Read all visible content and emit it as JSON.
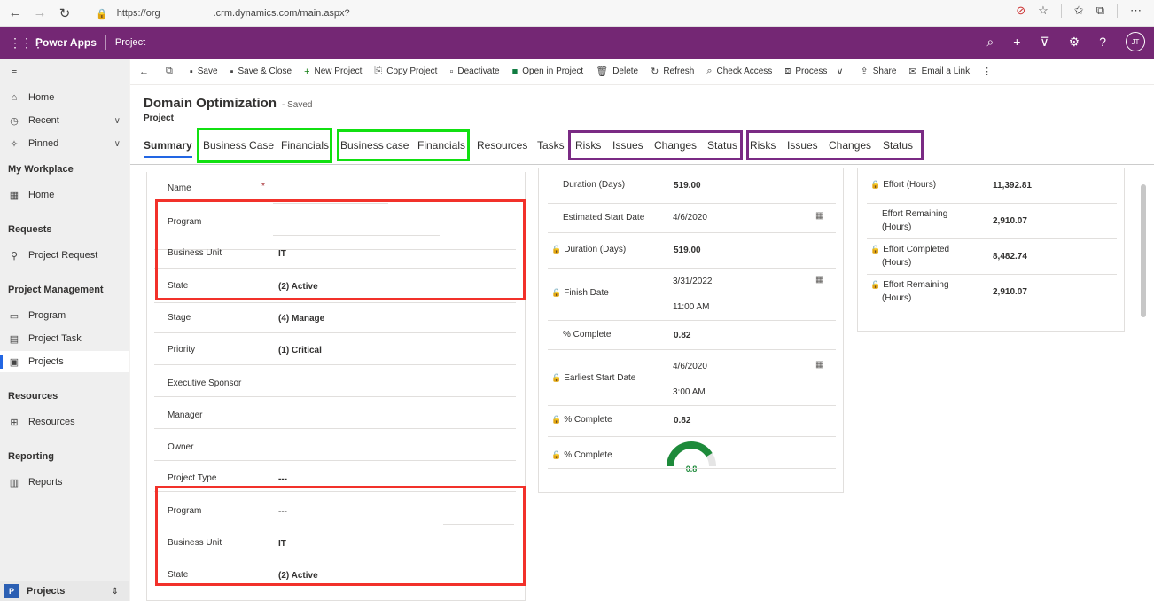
{
  "browser": {
    "url_left": "https://org",
    "url_right": ".crm.dynamics.com/main.aspx?"
  },
  "appbar": {
    "brand": "Power Apps",
    "app": "Project",
    "avatar": "JT"
  },
  "sidebar": {
    "home": "Home",
    "recent": "Recent",
    "pinned": "Pinned",
    "groups": [
      {
        "title": "My Workplace",
        "items": [
          "Home"
        ]
      },
      {
        "title": "Requests",
        "items": [
          "Project Request"
        ]
      },
      {
        "title": "Project Management",
        "items": [
          "Program",
          "Project Task",
          "Projects"
        ]
      },
      {
        "title": "Resources",
        "items": [
          "Resources"
        ]
      },
      {
        "title": "Reporting",
        "items": [
          "Reports"
        ]
      }
    ],
    "area": {
      "badge": "P",
      "label": "Projects"
    }
  },
  "commands": [
    "Save",
    "Save & Close",
    "New Project",
    "Copy Project",
    "Deactivate",
    "Open in Project",
    "Delete",
    "Refresh",
    "Check Access",
    "Process",
    "Share",
    "Email a Link"
  ],
  "record": {
    "title": "Domain Optimization",
    "saved": "- Saved",
    "entity": "Project"
  },
  "tabs": [
    "Summary",
    "Business Case",
    "Financials",
    "Business case",
    "Financials",
    "Resources",
    "Tasks",
    "Risks",
    "Issues",
    "Changes",
    "Status",
    "Risks",
    "Issues",
    "Changes",
    "Status"
  ],
  "left_form": [
    {
      "label": "Name",
      "value": "",
      "required": "*"
    },
    {
      "label": "Program",
      "value": ""
    },
    {
      "label": "Business Unit",
      "value": "IT"
    },
    {
      "label": "State",
      "value": "(2) Active"
    },
    {
      "label": "Stage",
      "value": "(4) Manage"
    },
    {
      "label": "Priority",
      "value": "(1) Critical"
    },
    {
      "label": "Executive Sponsor",
      "value": ""
    },
    {
      "label": "Manager",
      "value": ""
    },
    {
      "label": "Owner",
      "value": ""
    },
    {
      "label": "Project Type",
      "value": "---"
    },
    {
      "label": "Program",
      "value": "---"
    },
    {
      "label": "Business Unit",
      "value": "IT"
    },
    {
      "label": "State",
      "value": "(2) Active"
    }
  ],
  "mid_form": {
    "duration1": {
      "label": "Duration (Days)",
      "value": "519.00"
    },
    "est_start": {
      "label": "Estimated Start Date",
      "value": "4/6/2020"
    },
    "duration2": {
      "label": "Duration (Days)",
      "value": "519.00"
    },
    "finish": {
      "label": "Finish Date",
      "date": "3/31/2022",
      "time": "11:00 AM"
    },
    "pct1": {
      "label": "% Complete",
      "value": "0.82"
    },
    "earliest": {
      "label": "Earliest Start Date",
      "date": "4/6/2020",
      "time": "3:00 AM"
    },
    "pct2": {
      "label": "% Complete",
      "value": "0.82"
    },
    "pct3": {
      "label": "% Complete",
      "gauge_label": "0.8",
      "gauge_value": 0.82
    }
  },
  "right_form": [
    {
      "label": "Effort (Hours)",
      "value": "11,392.81",
      "locked": true
    },
    {
      "label": "Effort Remaining",
      "label2": "(Hours)",
      "value": "2,910.07",
      "locked": false
    },
    {
      "label": "Effort Completed",
      "label2": "(Hours)",
      "value": "8,482.74",
      "locked": true
    },
    {
      "label": "Effort Remaining",
      "label2": "(Hours)",
      "value": "2,910.07",
      "locked": true
    }
  ],
  "colors": {
    "appbar": "#742774",
    "green_box": "#11e011",
    "purple_box": "#7a2a84",
    "red_box": "#f2312a",
    "accent": "#2266e3"
  }
}
